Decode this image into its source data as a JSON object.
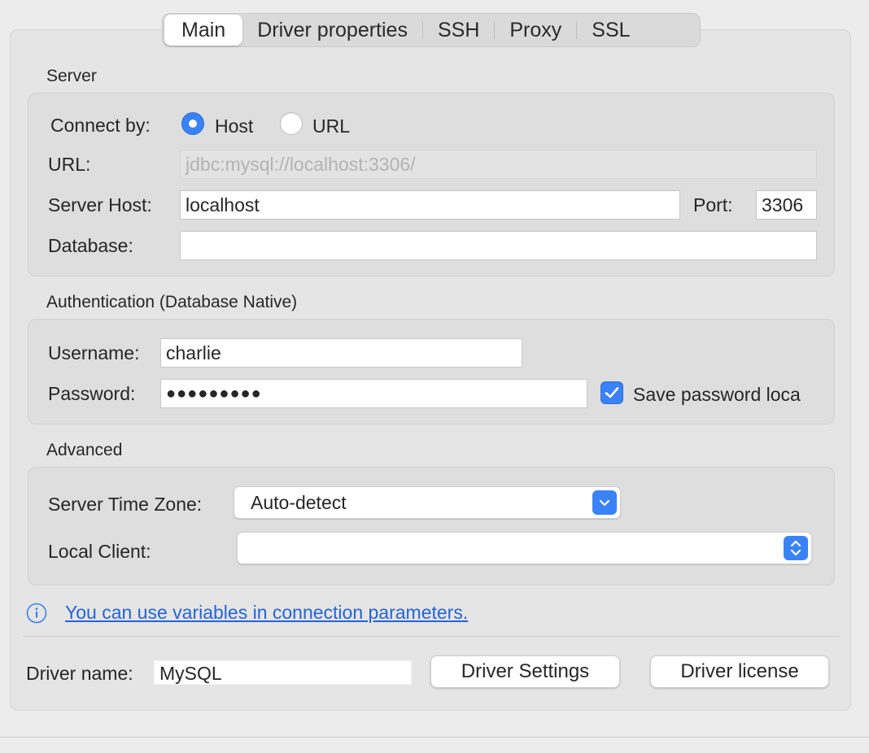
{
  "tabs": [
    {
      "label": "Main",
      "active": true
    },
    {
      "label": "Driver properties",
      "active": false
    },
    {
      "label": "SSH",
      "active": false
    },
    {
      "label": "Proxy",
      "active": false
    },
    {
      "label": "SSL",
      "active": false
    }
  ],
  "server": {
    "title": "Server",
    "connect_by_label": "Connect by:",
    "option_host": "Host",
    "option_url": "URL",
    "selected": "Host",
    "url_label": "URL:",
    "url_value": "jdbc:mysql://localhost:3306/",
    "host_label": "Server Host:",
    "host_value": "localhost",
    "port_label": "Port:",
    "port_value": "3306",
    "database_label": "Database:",
    "database_value": ""
  },
  "auth": {
    "title": "Authentication (Database Native)",
    "username_label": "Username:",
    "username_value": "charlie",
    "password_label": "Password:",
    "password_value": "●●●●●●●●●",
    "save_password_label": "Save password loca",
    "save_password_checked": true
  },
  "advanced": {
    "title": "Advanced",
    "timezone_label": "Server Time Zone:",
    "timezone_value": "Auto-detect",
    "local_client_label": "Local Client:",
    "local_client_value": ""
  },
  "info": {
    "icon": "info-icon",
    "link_text": "You can use variables in connection parameters."
  },
  "driver": {
    "name_label": "Driver name:",
    "name_value": "MySQL",
    "settings_button": "Driver Settings",
    "license_button": "Driver license"
  },
  "colors": {
    "accent": "#3a82f7",
    "link": "#2465d6"
  }
}
